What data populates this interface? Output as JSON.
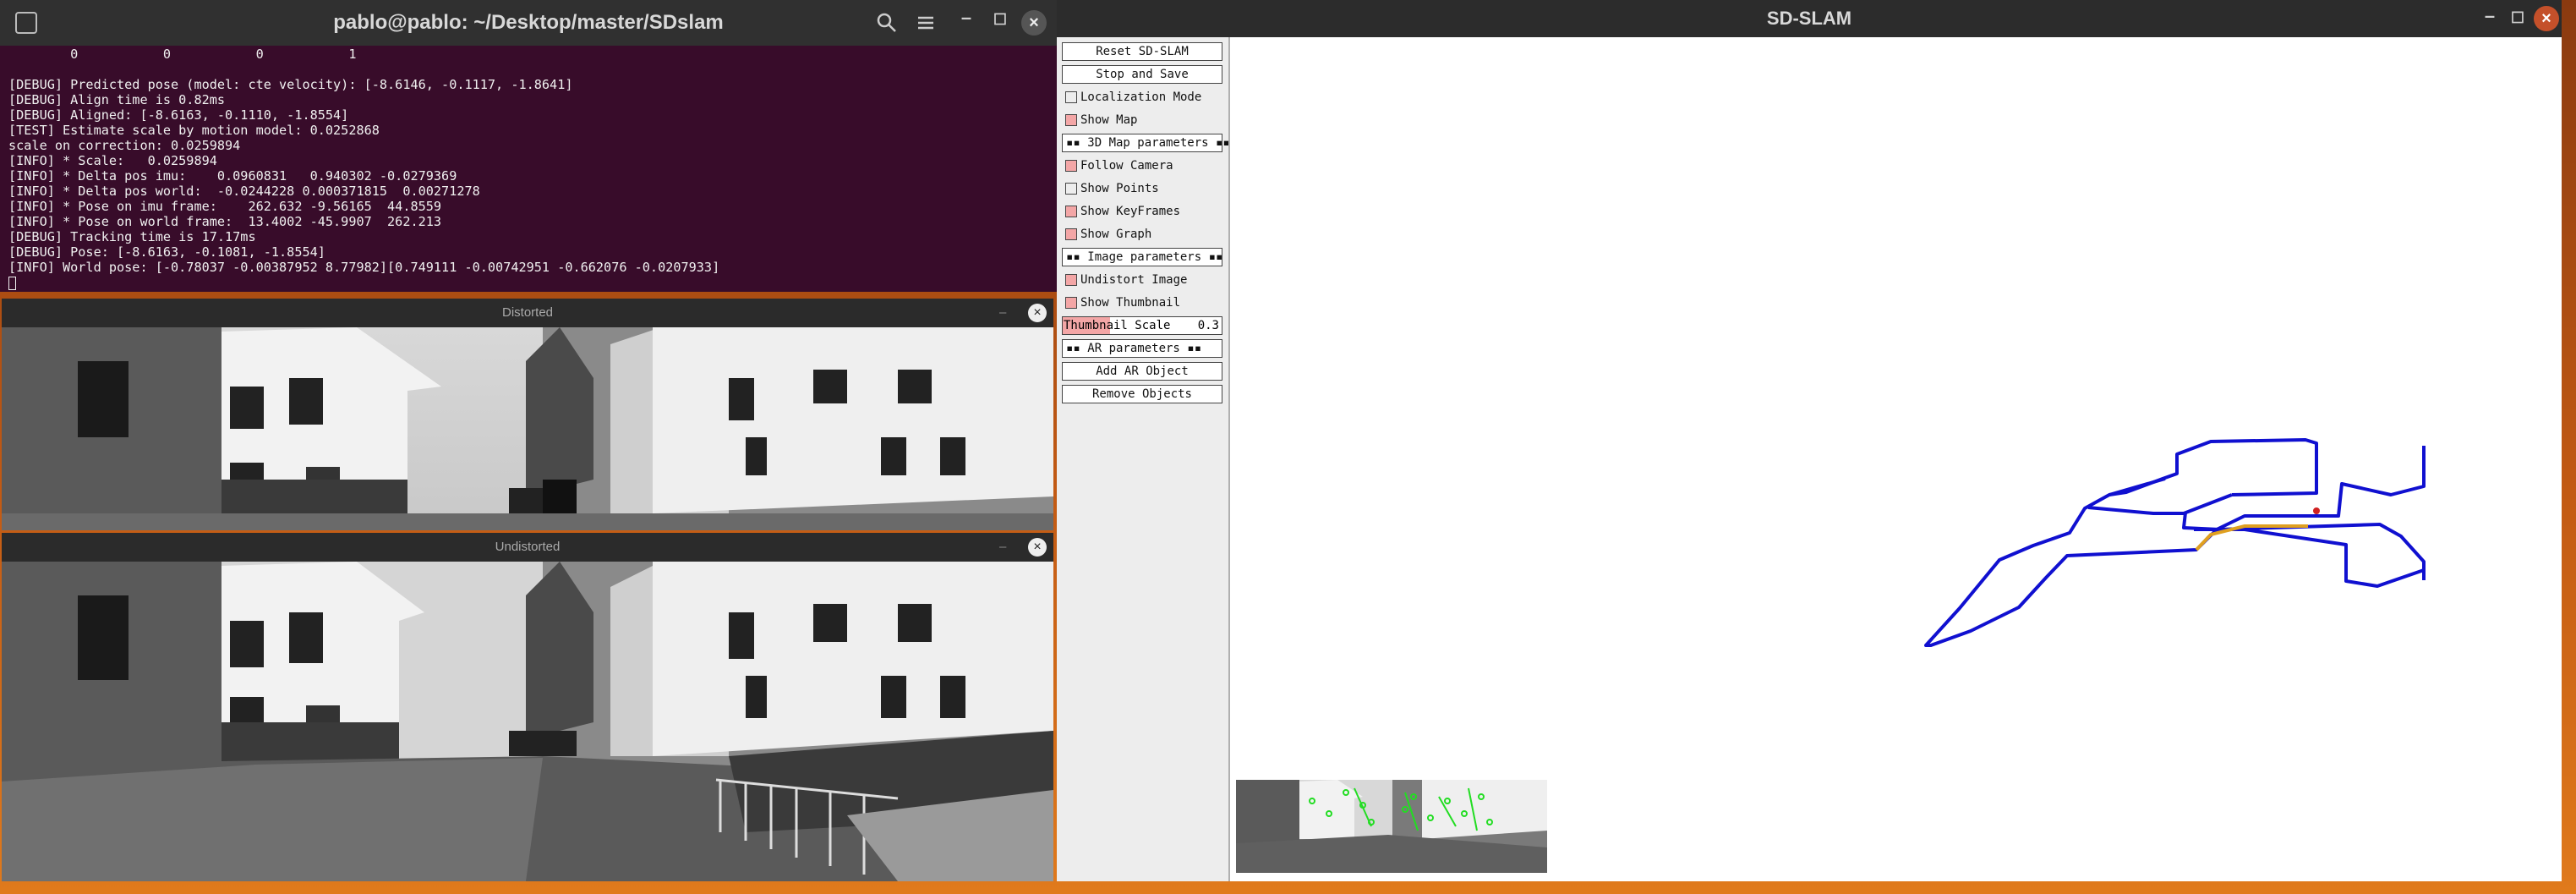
{
  "terminal": {
    "title": "pablo@pablo: ~/Desktop/master/SDslam",
    "lines": [
      "        0           0           0           1",
      "",
      "[DEBUG] Predicted pose (model: cte velocity): [-8.6146, -0.1117, -1.8641]",
      "[DEBUG] Align time is 0.82ms",
      "[DEBUG] Aligned: [-8.6163, -0.1110, -1.8554]",
      "[TEST] Estimate scale by motion model: 0.0252868",
      "scale on correction: 0.0259894",
      "[INFO] * Scale:   0.0259894",
      "[INFO] * Delta pos imu:    0.0960831   0.940302 -0.0279369",
      "[INFO] * Delta pos world:  -0.0244228 0.000371815  0.00271278",
      "[INFO] * Pose on imu frame:    262.632 -9.56165  44.8559",
      "[INFO] * Pose on world frame:  13.4002 -45.9907  262.213",
      "[DEBUG] Tracking time is 17.17ms",
      "[DEBUG] Pose: [-8.6163, -0.1081, -1.8554]",
      "[INFO] World pose: [-0.78037 -0.00387952 8.77982][0.749111 -0.00742951 -0.662076 -0.0207933]"
    ]
  },
  "distorted_window": {
    "title": "Distorted"
  },
  "undistorted_window": {
    "title": "Undistorted"
  },
  "slam_window": {
    "title": "SD-SLAM"
  },
  "panel": {
    "reset": "Reset SD-SLAM",
    "stop_save": "Stop and Save",
    "localization_mode": "Localization Mode",
    "show_map": "Show Map",
    "map3d_header": "▪▪ 3D Map parameters ▪▪",
    "follow_camera": "Follow Camera",
    "show_points": "Show Points",
    "show_keyframes": "Show KeyFrames",
    "show_graph": "Show Graph",
    "image_header": "▪▪ Image parameters ▪▪",
    "undistort_image": "Undistort Image",
    "show_thumbnail": "Show Thumbnail",
    "thumbnail_scale_label": "Thumbnail Scale",
    "thumbnail_scale_value": "0.3",
    "ar_header": "▪▪ AR parameters ▪▪",
    "add_ar": "Add AR Object",
    "remove_objects": "Remove Objects"
  },
  "colors": {
    "trajectory": "#1010d0",
    "current_segment": "#e0a020",
    "checkbox_on": "#f3a6a6",
    "terminal_bg": "#380c2a"
  },
  "icons": {
    "terminal_tab": "tab-icon",
    "search": "search-icon",
    "menu": "hamburger-icon",
    "minimize": "minimize-icon",
    "maximize": "maximize-icon",
    "close": "close-icon"
  }
}
